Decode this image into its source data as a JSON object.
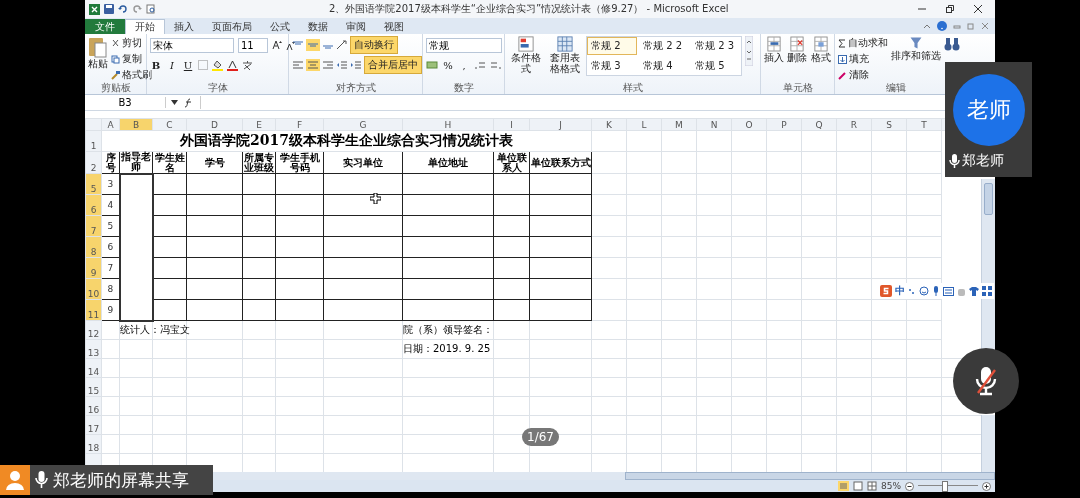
{
  "window": {
    "title": "2、外国语学院2017级本科学生“企业综合实习”情况统计表（修9.27） - Microsoft Excel"
  },
  "ribbon_tabs": [
    {
      "label": "文件",
      "kind": "file",
      "selected": false
    },
    {
      "label": "开始",
      "kind": "tab",
      "selected": true
    },
    {
      "label": "插入",
      "kind": "tab",
      "selected": false
    },
    {
      "label": "页面布局",
      "kind": "tab",
      "selected": false
    },
    {
      "label": "公式",
      "kind": "tab",
      "selected": false
    },
    {
      "label": "数据",
      "kind": "tab",
      "selected": false
    },
    {
      "label": "审阅",
      "kind": "tab",
      "selected": false
    },
    {
      "label": "视图",
      "kind": "tab",
      "selected": false
    }
  ],
  "clipboard": {
    "label": "剪贴板",
    "paste": "粘贴",
    "cut": "剪切",
    "copy": "复制",
    "painter": "格式刷"
  },
  "font": {
    "label": "字体",
    "name": "宋体",
    "size": "11",
    "bold": "B",
    "italic": "I",
    "underline": "U"
  },
  "alignment": {
    "label": "对齐方式",
    "wrap": {
      "label": "自动换行",
      "on": true
    },
    "merge": {
      "label": "合并后居中",
      "on": true
    }
  },
  "number": {
    "label": "数字",
    "format": "常规",
    "percent": "%",
    "comma": ","
  },
  "styles": {
    "label": "样式",
    "conditional": "条件格式",
    "table_format": "套用表格格式",
    "gallery": [
      {
        "label": "常规 2",
        "selected": true
      },
      {
        "label": "常规 2 2",
        "selected": false
      },
      {
        "label": "常规 2 3",
        "selected": false
      },
      {
        "label": "常规 3",
        "selected": false
      },
      {
        "label": "常规 4",
        "selected": false
      },
      {
        "label": "常规 5",
        "selected": false
      }
    ]
  },
  "cells": {
    "label": "单元格",
    "buttons": [
      "插入",
      "删除",
      "格式"
    ]
  },
  "editing": {
    "label": "编辑",
    "autosum": "自动求和",
    "fill": "填充",
    "clear": "清除",
    "sort": "排序和筛选"
  },
  "name_box": "B3",
  "columns": [
    {
      "label": "A",
      "selected": false
    },
    {
      "label": "B",
      "selected": true
    },
    {
      "label": "C",
      "selected": false
    },
    {
      "label": "D",
      "selected": false
    },
    {
      "label": "E",
      "selected": false
    },
    {
      "label": "F",
      "selected": false
    },
    {
      "label": "G",
      "selected": false
    },
    {
      "label": "H",
      "selected": false
    },
    {
      "label": "I",
      "selected": false
    },
    {
      "label": "J",
      "selected": false
    },
    {
      "label": "K",
      "selected": false
    },
    {
      "label": "L",
      "selected": false
    },
    {
      "label": "M",
      "selected": false
    },
    {
      "label": "N",
      "selected": false
    },
    {
      "label": "O",
      "selected": false
    },
    {
      "label": "P",
      "selected": false
    },
    {
      "label": "Q",
      "selected": false
    },
    {
      "label": "R",
      "selected": false
    },
    {
      "label": "S",
      "selected": false
    },
    {
      "label": "T",
      "selected": false
    }
  ],
  "rows": [
    {
      "number": "1",
      "selected": false
    },
    {
      "number": "2",
      "selected": false
    },
    {
      "number": "5",
      "selected": true
    },
    {
      "number": "6",
      "selected": true
    },
    {
      "number": "7",
      "selected": true
    },
    {
      "number": "8",
      "selected": true
    },
    {
      "number": "9",
      "selected": true
    },
    {
      "number": "10",
      "selected": true
    },
    {
      "number": "11",
      "selected": true
    },
    {
      "number": "12",
      "selected": false
    },
    {
      "number": "13",
      "selected": false
    },
    {
      "number": "14",
      "selected": false
    },
    {
      "number": "15",
      "selected": false
    },
    {
      "number": "16",
      "selected": false
    },
    {
      "number": "17",
      "selected": false
    },
    {
      "number": "18",
      "selected": false
    }
  ],
  "sheet": {
    "title": "外国语学院2017级本科学生企业综合实习情况统计表",
    "headers": [
      "序号",
      "指导老师",
      "学生姓名",
      "学号",
      "所属专业班级",
      "学生手机号码",
      "实习单位",
      "单位地址",
      "单位联系人",
      "单位联系方式"
    ],
    "serials": [
      "3",
      "4",
      "5",
      "6",
      "7",
      "8",
      "9"
    ],
    "compiler": "统计人：冯宝文",
    "signature": "院（系）领导签名：",
    "date": "日期：2019. 9. 25"
  },
  "status_bar": {
    "zoom": "85%",
    "level": 0.45
  },
  "presenter": {
    "avatar": "老师",
    "name": "郑老师"
  },
  "ime_toolbar": {
    "mode": "中"
  },
  "page_counter": "1/67",
  "mic_muted": true,
  "share_banner": "郑老师的屏幕共享"
}
